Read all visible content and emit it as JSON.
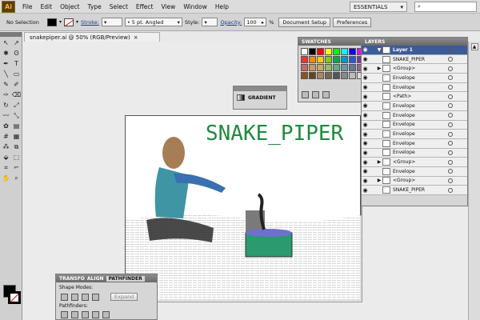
{
  "app": {
    "logo": "Ai"
  },
  "menu": [
    "File",
    "Edit",
    "Object",
    "Type",
    "Select",
    "Effect",
    "View",
    "Window",
    "Help"
  ],
  "workspace": {
    "label": "ESSENTIALS"
  },
  "control_bar": {
    "selection": "No Selection",
    "stroke_label": "Stroke:",
    "brush": "5 pt. Angled",
    "style_label": "Style:",
    "opacity_label": "Opacity:",
    "opacity_value": "100",
    "opacity_unit": "%",
    "document_setup": "Document Setup",
    "preferences": "Preferences"
  },
  "document": {
    "tab": "snakepiper.ai @ 50% (RGB/Preview)"
  },
  "artwork": {
    "title": "SNAKE_PIPER"
  },
  "swatches": {
    "title": "SWATCHES",
    "colors": [
      "#ffffff",
      "#000000",
      "#ff0000",
      "#ffff00",
      "#00ff00",
      "#00ffff",
      "#0000ff",
      "#ff00ff",
      "#ee3333",
      "#ff8800",
      "#ffcc00",
      "#88cc00",
      "#00aa44",
      "#0099cc",
      "#3355cc",
      "#883399",
      "#cc6666",
      "#cc9966",
      "#ccaa55",
      "#99bb66",
      "#66aa88",
      "#6699aa",
      "#667799",
      "#996688",
      "#885522",
      "#664422",
      "#aa8866",
      "#776655",
      "#555555",
      "#888888",
      "#bbbbbb",
      "#dddddd"
    ]
  },
  "gradient": {
    "title": "GRADIENT"
  },
  "layers": {
    "title": "LAYERS",
    "rows": [
      {
        "name": "Layer 1",
        "top": true,
        "tri": "▼"
      },
      {
        "name": "SNAKE_PIPER",
        "tri": ""
      },
      {
        "name": "<Group>",
        "tri": "▶"
      },
      {
        "name": "Envelope",
        "tri": ""
      },
      {
        "name": "Envelope",
        "tri": ""
      },
      {
        "name": "<Path>",
        "tri": ""
      },
      {
        "name": "Envelope",
        "tri": ""
      },
      {
        "name": "Envelope",
        "tri": ""
      },
      {
        "name": "Envelope",
        "tri": ""
      },
      {
        "name": "Envelope",
        "tri": ""
      },
      {
        "name": "Envelope",
        "tri": ""
      },
      {
        "name": "Envelope",
        "tri": ""
      },
      {
        "name": "<Group>",
        "tri": "▶"
      },
      {
        "name": "Envelope",
        "tri": ""
      },
      {
        "name": "<Group>",
        "tri": "▶"
      },
      {
        "name": "SNAKE_PIPER",
        "tri": ""
      }
    ]
  },
  "pathfinder": {
    "tab1": "TRANSFO",
    "tab2": "ALIGN",
    "tab3": "PATHFINDER",
    "shape_modes": "Shape Modes:",
    "expand": "Expand",
    "pathfinders": "Pathfinders:"
  }
}
